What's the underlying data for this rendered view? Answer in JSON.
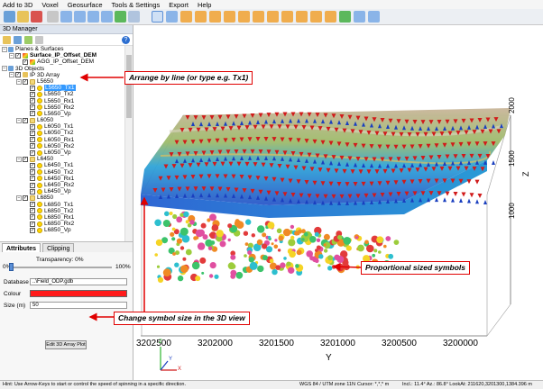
{
  "menu": [
    "Add to 3D",
    "Voxel",
    "Geosurface",
    "Tools & Settings",
    "Export",
    "Help"
  ],
  "panel": {
    "title": "3D Manager",
    "tree": [
      {
        "label": "Planes & Surfaces",
        "indent": 0,
        "exp": "−",
        "icon": "objects",
        "cb": false
      },
      {
        "label": "Surface_IP_Offset_DEM",
        "indent": 1,
        "exp": "−",
        "icon": "surface",
        "cb": true,
        "bold": true
      },
      {
        "label": "AGG_IP_Offset_DEM",
        "indent": 2,
        "exp": "",
        "icon": "surface",
        "cb": true
      },
      {
        "label": "3D Objects",
        "indent": 0,
        "exp": "−",
        "icon": "objects",
        "cb": false
      },
      {
        "label": "IP 3D Array",
        "indent": 1,
        "exp": "−",
        "icon": "folder",
        "cb": true
      },
      {
        "label": "L5650",
        "indent": 2,
        "exp": "−",
        "icon": "line",
        "cb": true
      },
      {
        "label": "L5650_Tx1",
        "indent": 3,
        "exp": "",
        "icon": "sensor",
        "cb": true,
        "selected": true
      },
      {
        "label": "L5650_Tx2",
        "indent": 3,
        "exp": "",
        "icon": "sensor",
        "cb": true
      },
      {
        "label": "L5650_Rx1",
        "indent": 3,
        "exp": "",
        "icon": "sensor",
        "cb": true
      },
      {
        "label": "L5650_Rx2",
        "indent": 3,
        "exp": "",
        "icon": "sensor",
        "cb": true
      },
      {
        "label": "L5650_Vp",
        "indent": 3,
        "exp": "",
        "icon": "sensor",
        "cb": true
      },
      {
        "label": "L6050",
        "indent": 2,
        "exp": "−",
        "icon": "line",
        "cb": true
      },
      {
        "label": "L6050_Tx1",
        "indent": 3,
        "exp": "",
        "icon": "sensor",
        "cb": true
      },
      {
        "label": "L6050_Tx2",
        "indent": 3,
        "exp": "",
        "icon": "sensor",
        "cb": true
      },
      {
        "label": "L6050_Rx1",
        "indent": 3,
        "exp": "",
        "icon": "sensor",
        "cb": true
      },
      {
        "label": "L6050_Rx2",
        "indent": 3,
        "exp": "",
        "icon": "sensor",
        "cb": true
      },
      {
        "label": "L6050_Vp",
        "indent": 3,
        "exp": "",
        "icon": "sensor",
        "cb": true
      },
      {
        "label": "L6450",
        "indent": 2,
        "exp": "−",
        "icon": "line",
        "cb": true
      },
      {
        "label": "L6450_Tx1",
        "indent": 3,
        "exp": "",
        "icon": "sensor",
        "cb": true
      },
      {
        "label": "L6450_Tx2",
        "indent": 3,
        "exp": "",
        "icon": "sensor",
        "cb": true
      },
      {
        "label": "L6450_Rx1",
        "indent": 3,
        "exp": "",
        "icon": "sensor",
        "cb": true
      },
      {
        "label": "L6450_Rx2",
        "indent": 3,
        "exp": "",
        "icon": "sensor",
        "cb": true
      },
      {
        "label": "L6450_Vp",
        "indent": 3,
        "exp": "",
        "icon": "sensor",
        "cb": true
      },
      {
        "label": "L6850",
        "indent": 2,
        "exp": "−",
        "icon": "line",
        "cb": true
      },
      {
        "label": "L6850_Tx1",
        "indent": 3,
        "exp": "",
        "icon": "sensor",
        "cb": true
      },
      {
        "label": "L6850_Tx2",
        "indent": 3,
        "exp": "",
        "icon": "sensor",
        "cb": true
      },
      {
        "label": "L6850_Rx1",
        "indent": 3,
        "exp": "",
        "icon": "sensor",
        "cb": true
      },
      {
        "label": "L6850_Rx2",
        "indent": 3,
        "exp": "",
        "icon": "sensor",
        "cb": true
      },
      {
        "label": "L6850_Vp",
        "indent": 3,
        "exp": "",
        "icon": "sensor",
        "cb": true
      }
    ]
  },
  "tabs": {
    "attributes": "Attributes",
    "clipping": "Clipping"
  },
  "attributes": {
    "transparency_label": "Transparency: 0%",
    "pct_min": "0%",
    "pct_max": "100%",
    "database_label": "Database",
    "database_value": "..\\Field_ODP.gdb",
    "colour_label": "Colour",
    "colour_value": "#ff1a1a",
    "size_label": "Size (m)",
    "size_value": "50",
    "edit_button": "Edit 3D Array Plot"
  },
  "view": {
    "y_ticks": [
      "3202500",
      "3202000",
      "3201500",
      "3201000",
      "3200500",
      "3200000"
    ],
    "y_axis_label": "Y",
    "z_ticks": [
      "2000",
      "1500",
      "1000"
    ],
    "z_axis_label": "Z",
    "axis_labels": {
      "x": "X",
      "y": "Y",
      "z": "Z"
    }
  },
  "callouts": {
    "arrange": "Arrange by line (or type e.g. Tx1)",
    "proportional": "Proportional sized symbols",
    "change_size": "Change symbol size in the 3D view"
  },
  "status": {
    "hint": "Hint: Use Arrow-Keys to start or control the speed of spinning in a specific direction.",
    "crs": "WGS 84 / UTM zone 11N",
    "cursor": "Cursor: *,*,* m",
    "look": "Incl.: 11.4° Az.: 86.8° LookAt: 211620,3201300,1384.396 m"
  },
  "colors": {
    "accent": "#e00000",
    "selection": "#3399ff"
  }
}
